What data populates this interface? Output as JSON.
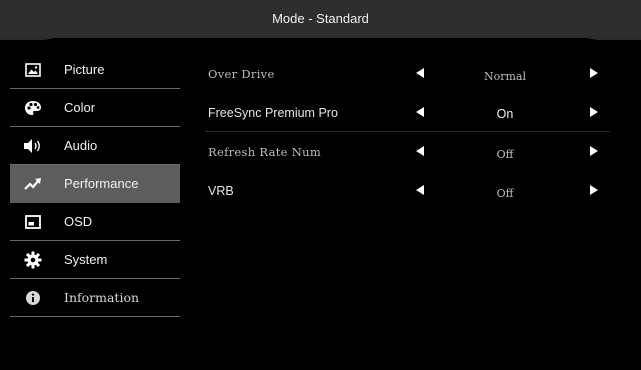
{
  "header": {
    "title": "Mode - Standard"
  },
  "sidebar": {
    "items": [
      {
        "label": "Picture",
        "icon": "picture-icon"
      },
      {
        "label": "Color",
        "icon": "palette-icon"
      },
      {
        "label": "Audio",
        "icon": "speaker-icon"
      },
      {
        "label": "Performance",
        "icon": "trend-icon",
        "selected": true
      },
      {
        "label": "OSD",
        "icon": "osd-icon"
      },
      {
        "label": "System",
        "icon": "gear-icon"
      },
      {
        "label": "Information",
        "icon": "info-icon"
      }
    ]
  },
  "settings": [
    {
      "label": "Over Drive",
      "value": "Normal"
    },
    {
      "label": "FreeSync Premium Pro",
      "value": "On",
      "highlighted": true
    },
    {
      "label": "Refresh Rate Num",
      "value": "Off"
    },
    {
      "label": "VRB",
      "value": "Off"
    }
  ],
  "colors": {
    "background": "#000000",
    "header": "#2e2e2e",
    "selected": "#5d5d5d",
    "text": "#f0f0f0"
  }
}
